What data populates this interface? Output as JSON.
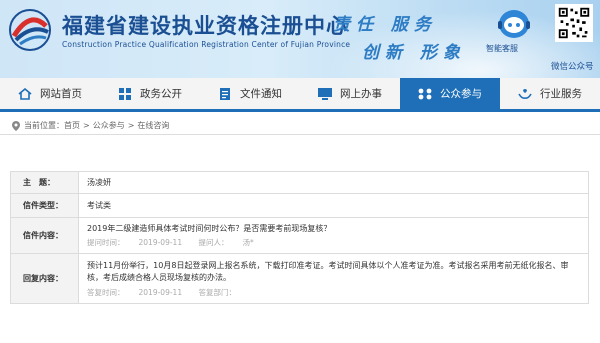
{
  "header": {
    "title": "福建省建设执业资格注册中心",
    "subtitle": "Construction Practice Qualification Registration Center of Fujian Province",
    "slogan_line1": "责任 服务",
    "slogan_line2": "创新 形象",
    "assistant_label": "智能客服",
    "wechat_label": "微信公众号",
    "brand_color": "#1b4f93"
  },
  "nav": {
    "accent_color": "#1e6fb8",
    "items": [
      {
        "label": "网站首页",
        "icon": "home-icon"
      },
      {
        "label": "政务公开",
        "icon": "grid-icon"
      },
      {
        "label": "文件通知",
        "icon": "document-icon"
      },
      {
        "label": "网上办事",
        "icon": "monitor-icon"
      },
      {
        "label": "公众参与",
        "icon": "dots-grid-icon",
        "active": true
      },
      {
        "label": "行业服务",
        "icon": "hands-icon"
      }
    ]
  },
  "breadcrumb": {
    "prefix": "当前位置：",
    "items": [
      "首页",
      "公众参与",
      "在线咨询"
    ],
    "separator": ">"
  },
  "message": {
    "subject_label": "主　题：",
    "subject": "汤凌妍",
    "type_label": "信件类型：",
    "type": "考试类",
    "content_label": "信件内容：",
    "content": "2019年二级建造师具体考试时间何时公布？是否需要考前现场复核？",
    "submit_time_label": "提问时间：",
    "submit_time": "2019-09-11",
    "submitter_label": "提问人：",
    "submitter": "汤*",
    "reply_label": "回复内容：",
    "reply": "预计11月份举行，10月8日起登录网上报名系统，下载打印准考证。考试时间具体以个人准考证为准。考试报名采用考前无纸化报名、审核，考后成绩合格人员现场复核的办法。",
    "reply_time_label": "答复时间：",
    "reply_time": "2019-09-11",
    "reply_dept_label": "答复部门："
  }
}
